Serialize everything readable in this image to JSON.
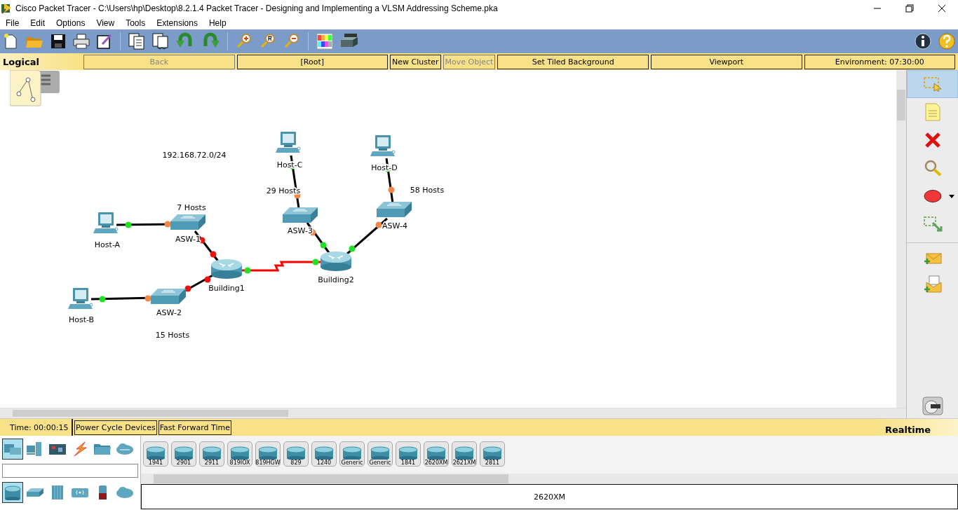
{
  "window": {
    "title": "Cisco Packet Tracer - C:\\Users\\hp\\Desktop\\8.2.1.4 Packet Tracer - Designing and Implementing a VLSM Addressing Scheme.pka"
  },
  "menu": [
    "File",
    "Edit",
    "Options",
    "View",
    "Tools",
    "Extensions",
    "Help"
  ],
  "workspace_bar": {
    "tab": "Logical",
    "buttons": [
      {
        "label": "Back",
        "kind": "wide",
        "disabled": true
      },
      {
        "label": "[Root]",
        "kind": "wide",
        "disabled": false
      },
      {
        "label": "New Cluster",
        "kind": "compact",
        "disabled": false
      },
      {
        "label": "Move Object",
        "kind": "compact",
        "disabled": true
      },
      {
        "label": "Set Tiled Background",
        "kind": "wide",
        "disabled": false
      },
      {
        "label": "Viewport",
        "kind": "wide",
        "disabled": false
      },
      {
        "label": "Environment: 07:30:00",
        "kind": "wide",
        "disabled": false
      }
    ]
  },
  "network": {
    "notes": [
      "192.168.72.0/24",
      "7 Hosts",
      "29 Hosts",
      "58 Hosts",
      "15 Hosts"
    ],
    "nodes": [
      {
        "kind": "pc",
        "label": "Host-A"
      },
      {
        "kind": "pc",
        "label": "Host-B"
      },
      {
        "kind": "pc",
        "label": "Host-C"
      },
      {
        "kind": "pc",
        "label": "Host-D"
      },
      {
        "kind": "switch",
        "label": "ASW-1"
      },
      {
        "kind": "switch",
        "label": "ASW-2"
      },
      {
        "kind": "switch",
        "label": "ASW-3"
      },
      {
        "kind": "switch",
        "label": "ASW-4"
      },
      {
        "kind": "router",
        "label": "Building1"
      },
      {
        "kind": "router",
        "label": "Building2"
      }
    ],
    "links": [
      {
        "kind": "ethernet",
        "ends": [
          {
            "color": "#22e022"
          },
          {
            "color": "#f0884a"
          }
        ]
      },
      {
        "kind": "ethernet",
        "ends": [
          {
            "color": "#22e022"
          },
          {
            "color": "#f0884a"
          }
        ]
      },
      {
        "kind": "ethernet",
        "ends": [
          {
            "color": "#ee1111"
          },
          {
            "color": "#ee1111"
          }
        ]
      },
      {
        "kind": "ethernet",
        "ends": [
          {
            "color": "#ee1111"
          },
          {
            "color": "#ee1111"
          }
        ]
      },
      {
        "kind": "serial",
        "ends": [
          {
            "color": "#22e022"
          },
          {
            "color": "#22e022"
          }
        ]
      },
      {
        "kind": "ethernet",
        "ends": [
          {
            "color": "#22e022"
          },
          {
            "color": "#f0884a"
          }
        ]
      },
      {
        "kind": "ethernet",
        "ends": [
          {
            "color": "#f0884a"
          },
          {
            "color": "#22e022"
          }
        ]
      },
      {
        "kind": "ethernet",
        "ends": [
          {
            "color": "#22e022"
          },
          {
            "color": "#f0884a"
          }
        ]
      },
      {
        "kind": "ethernet",
        "ends": [
          {
            "color": "#f0884a"
          },
          {
            "color": "#22e022"
          }
        ]
      }
    ]
  },
  "tools": [
    {
      "kind": "select",
      "selected": true
    },
    {
      "kind": "note",
      "selected": false
    },
    {
      "kind": "delete",
      "selected": false
    },
    {
      "kind": "inspect",
      "selected": false
    },
    {
      "kind": "shape",
      "selected": false
    },
    {
      "kind": "resize",
      "selected": false
    },
    {
      "kind": "simple-pdu",
      "selected": false
    },
    {
      "kind": "complex-pdu",
      "selected": false
    }
  ],
  "status_bar": {
    "time": "Time: 00:00:15",
    "buttons": [
      "Power Cycle Devices",
      "Fast Forward Time"
    ],
    "mode": {
      "label": "Realtime",
      "selected": true
    }
  },
  "device_palette": {
    "categories": [
      {
        "kind": "network",
        "selected": true
      },
      {
        "kind": "end",
        "selected": false
      },
      {
        "kind": "component",
        "selected": false
      },
      {
        "kind": "connection",
        "selected": false
      },
      {
        "kind": "misc",
        "selected": false
      },
      {
        "kind": "multiuser",
        "selected": false
      }
    ],
    "subcategories": [
      {
        "kind": "router",
        "selected": true
      },
      {
        "kind": "switch",
        "selected": false
      },
      {
        "kind": "hub",
        "selected": false
      },
      {
        "kind": "wireless",
        "selected": false
      },
      {
        "kind": "security",
        "selected": false
      },
      {
        "kind": "wan",
        "selected": false
      }
    ],
    "devices": [
      "1941",
      "2901",
      "2911",
      "819IOX",
      "819HGW",
      "829",
      "1240",
      "Generic",
      "Generic",
      "1841",
      "2620XM",
      "2621XM",
      "2811"
    ],
    "selected_model": "2620XM"
  }
}
